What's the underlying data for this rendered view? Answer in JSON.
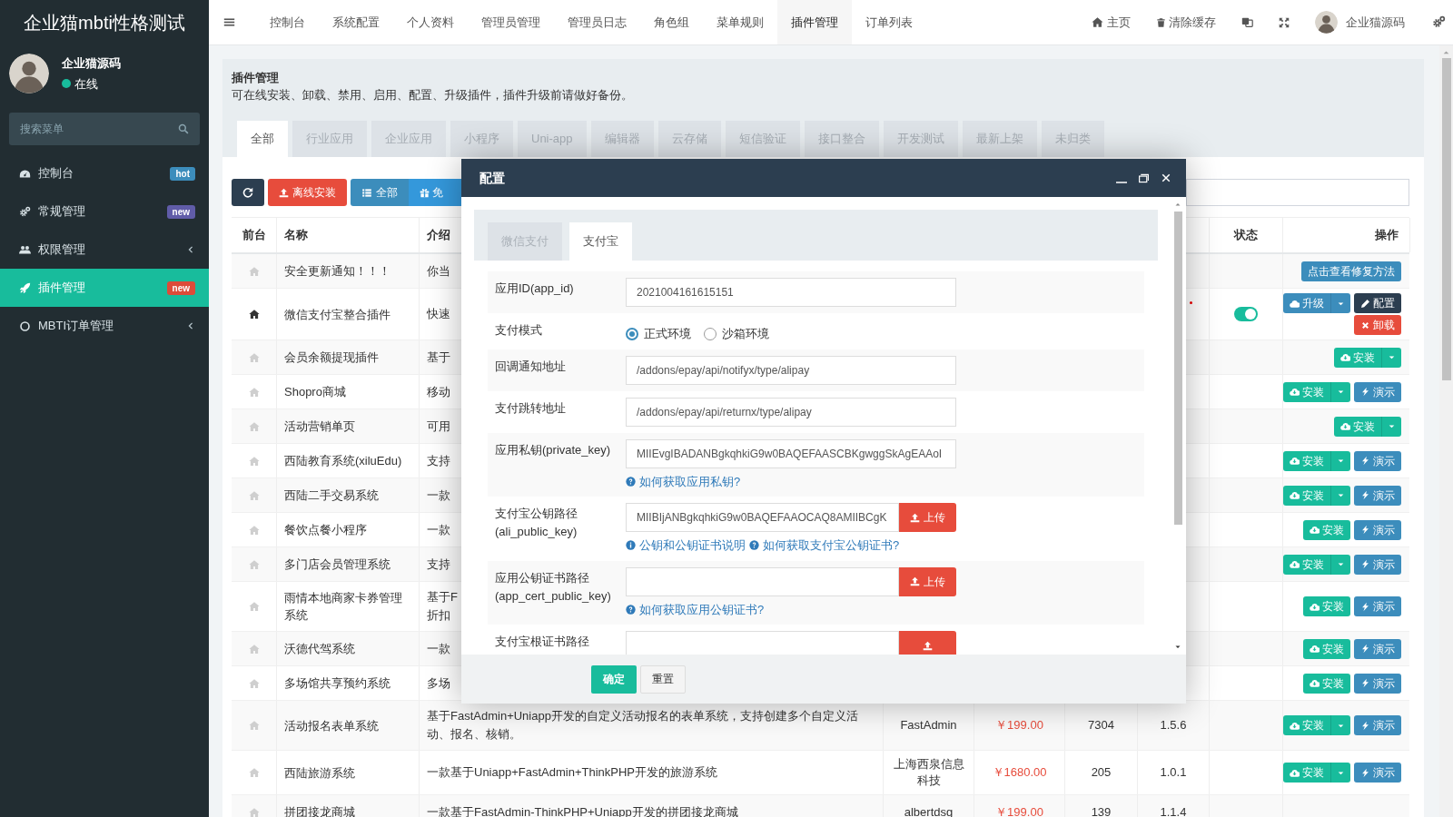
{
  "sidebar": {
    "title": "企业猫mbti性格测试",
    "user": {
      "name": "企业猫源码",
      "status": "在线",
      "online": true
    },
    "search": {
      "placeholder": "搜索菜单"
    },
    "items": [
      {
        "label": "控制台",
        "badge": {
          "text": "hot",
          "color": "#3c8dbc"
        },
        "expandable": false,
        "selected": false
      },
      {
        "label": "常规管理",
        "badge": {
          "text": "new",
          "color": "#605ca8"
        },
        "expandable": false,
        "selected": false
      },
      {
        "label": "权限管理",
        "expandable": true,
        "selected": false
      },
      {
        "label": "插件管理",
        "badge": {
          "text": "new",
          "color": "#dd4b39"
        },
        "expandable": false,
        "selected": true
      },
      {
        "label": "MBTI订单管理",
        "expandable": true,
        "selected": false
      }
    ]
  },
  "topnav": {
    "items": [
      {
        "label": "控制台",
        "selected": false
      },
      {
        "label": "系统配置",
        "selected": false
      },
      {
        "label": "个人资料",
        "selected": false
      },
      {
        "label": "管理员管理",
        "selected": false
      },
      {
        "label": "管理员日志",
        "selected": false
      },
      {
        "label": "角色组",
        "selected": false
      },
      {
        "label": "菜单规则",
        "selected": false
      },
      {
        "label": "插件管理",
        "selected": true
      },
      {
        "label": "订单列表",
        "selected": false
      }
    ],
    "home": "主页",
    "clear_cache": "清除缓存",
    "user": "企业猫源码"
  },
  "panel": {
    "title": "插件管理",
    "description": "可在线安装、卸载、禁用、启用、配置、升级插件，插件升级前请做好备份。",
    "tabs": [
      {
        "label": "全部",
        "selected": true
      },
      {
        "label": "行业应用",
        "selected": false
      },
      {
        "label": "企业应用",
        "selected": false
      },
      {
        "label": "小程序",
        "selected": false
      },
      {
        "label": "Uni-app",
        "selected": false
      },
      {
        "label": "编辑器",
        "selected": false
      },
      {
        "label": "云存储",
        "selected": false
      },
      {
        "label": "短信验证",
        "selected": false
      },
      {
        "label": "接口整合",
        "selected": false
      },
      {
        "label": "开发测试",
        "selected": false
      },
      {
        "label": "最新上架",
        "selected": false
      },
      {
        "label": "未归类",
        "selected": false
      }
    ]
  },
  "toolbar": [
    {
      "kind": "refresh"
    },
    {
      "kind": "offline",
      "label": "离线安装"
    },
    {
      "kind": "all",
      "label": "全部"
    },
    {
      "kind": "free",
      "label": "免"
    }
  ],
  "table": {
    "header_left": [
      "前台",
      "名称",
      "介绍"
    ],
    "header_right": [
      "状态",
      "操作"
    ],
    "rows": [
      {
        "front_active": false,
        "name": "安全更新通知！！！",
        "intro": "你当",
        "actions": [
          {
            "kind": "link",
            "label": "点击查看修复方法"
          }
        ]
      },
      {
        "front_active": true,
        "name": "微信支付宝整合插件",
        "intro": "快速",
        "new_mark": true,
        "status_on": true,
        "actions": [
          {
            "kind": "upgrade",
            "label": "升级",
            "caret": true
          },
          {
            "kind": "config",
            "label": "配置"
          },
          {
            "kind": "uninstall",
            "label": "卸载"
          }
        ]
      },
      {
        "front_active": false,
        "name": "会员余额提现插件",
        "intro": "基于",
        "actions": [
          {
            "kind": "install",
            "label": "安装",
            "caret": true
          }
        ]
      },
      {
        "front_active": false,
        "name": "Shopro商城",
        "intro": "移动",
        "actions": [
          {
            "kind": "install",
            "label": "安装",
            "caret": true
          },
          {
            "kind": "demo",
            "label": "演示"
          }
        ]
      },
      {
        "front_active": false,
        "name": "活动营销单页",
        "intro": "可用",
        "actions": [
          {
            "kind": "install",
            "label": "安装",
            "caret": true
          }
        ]
      },
      {
        "front_active": false,
        "name": "西陆教育系统(xiluEdu)",
        "intro": "支持",
        "actions": [
          {
            "kind": "install",
            "label": "安装",
            "caret": true
          },
          {
            "kind": "demo",
            "label": "演示"
          }
        ]
      },
      {
        "front_active": false,
        "name": "西陆二手交易系统",
        "intro": "一款",
        "actions": [
          {
            "kind": "install",
            "label": "安装",
            "caret": true
          },
          {
            "kind": "demo",
            "label": "演示"
          }
        ]
      },
      {
        "front_active": false,
        "name": "餐饮点餐小程序",
        "intro": "一款",
        "actions": [
          {
            "kind": "install",
            "label": "安装",
            "caret": false
          },
          {
            "kind": "demo",
            "label": "演示"
          }
        ]
      },
      {
        "front_active": false,
        "name": "多门店会员管理系统",
        "intro": "支持",
        "actions": [
          {
            "kind": "install",
            "label": "安装",
            "caret": true
          },
          {
            "kind": "demo",
            "label": "演示"
          }
        ]
      },
      {
        "front_active": false,
        "name": "雨情本地商家卡券管理系统",
        "intro": "基于F\n折扣",
        "actions": [
          {
            "kind": "install",
            "label": "安装",
            "caret": false
          },
          {
            "kind": "demo",
            "label": "演示"
          }
        ]
      },
      {
        "front_active": false,
        "name": "沃德代驾系统",
        "intro": "一款",
        "actions": [
          {
            "kind": "install",
            "label": "安装",
            "caret": false
          },
          {
            "kind": "demo",
            "label": "演示"
          }
        ]
      },
      {
        "front_active": false,
        "name": "多场馆共享预约系统",
        "intro": "多场",
        "actions": [
          {
            "kind": "install",
            "label": "安装",
            "caret": false
          },
          {
            "kind": "demo",
            "label": "演示"
          }
        ]
      },
      {
        "front_active": false,
        "name": "活动报名表单系统",
        "intro": "基于FastAdmin+Uniapp开发的自定义活动报名的表单系统，支持创建多个自定义活动、报名、核销。",
        "author": "FastAdmin",
        "price": "￥199.00",
        "downloads": "7304",
        "version": "1.5.6",
        "actions": [
          {
            "kind": "install",
            "label": "安装",
            "caret": true
          },
          {
            "kind": "demo",
            "label": "演示"
          }
        ]
      },
      {
        "front_active": false,
        "name": "西陆旅游系统",
        "intro": "一款基于Uniapp+FastAdmin+ThinkPHP开发的旅游系统",
        "author": "上海西泉信息科技",
        "price": "￥1680.00",
        "downloads": "205",
        "version": "1.0.1",
        "actions": [
          {
            "kind": "install",
            "label": "安装",
            "caret": true
          },
          {
            "kind": "demo",
            "label": "演示"
          }
        ]
      },
      {
        "front_active": false,
        "name": "拼团接龙商城",
        "intro": "一款基于FastAdmin-ThinkPHP+Uniapp开发的拼团接龙商城",
        "author": "albertdsg",
        "price": "￥199.00",
        "downloads": "139",
        "version": "1.1.4"
      }
    ]
  },
  "modal": {
    "title": "配置",
    "tabs": [
      {
        "label": "微信支付",
        "selected": false
      },
      {
        "label": "支付宝",
        "selected": true
      }
    ],
    "fields": [
      {
        "kind": "text",
        "label": "应用ID(app_id)",
        "value": "2021004161615151"
      },
      {
        "kind": "radio",
        "label": "支付模式",
        "options": [
          {
            "label": "正式环境",
            "selected": true
          },
          {
            "label": "沙箱环境",
            "selected": false
          }
        ]
      },
      {
        "kind": "text",
        "label": "回调通知地址",
        "value": "/addons/epay/api/notifyx/type/alipay"
      },
      {
        "kind": "text",
        "label": "支付跳转地址",
        "value": "/addons/epay/api/returnx/type/alipay"
      },
      {
        "kind": "text",
        "label": "应用私钥(private_key)",
        "value": "MIIEvgIBADANBgkqhkiG9w0BAQEFAASCBKgwggSkAgEAAoI",
        "help": [
          {
            "kind": "question",
            "text": "如何获取应用私钥?"
          }
        ]
      },
      {
        "kind": "upload",
        "label": "支付宝公钥路径(ali_public_key)",
        "value": "MIIBIjANBgkqhkiG9w0BAQEFAAOCAQ8AMIIBCgK",
        "button": "上传",
        "help": [
          {
            "kind": "info",
            "text": "公钥和公钥证书说明"
          },
          {
            "kind": "question",
            "text": "如何获取支付宝公钥证书?"
          }
        ]
      },
      {
        "kind": "upload",
        "label": "应用公钥证书路径(app_cert_public_key)",
        "button": "上传",
        "help": [
          {
            "kind": "question",
            "text": "如何获取应用公钥证书?"
          }
        ]
      },
      {
        "kind": "upload",
        "label": "支付宝根证书路径"
      }
    ],
    "buttons": [
      {
        "kind": "primary",
        "label": "确定"
      },
      {
        "kind": "default",
        "label": "重置"
      }
    ]
  }
}
